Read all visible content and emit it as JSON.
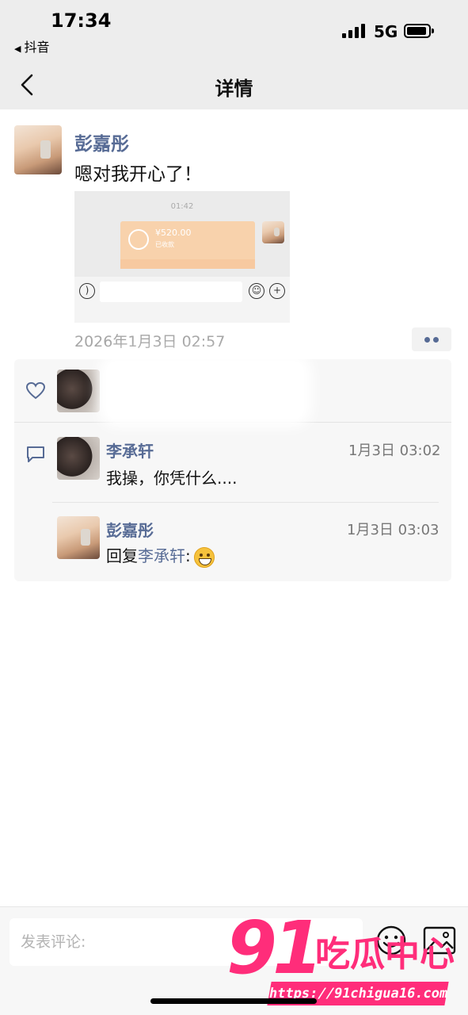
{
  "status_bar": {
    "time": "17:34",
    "back_app": "抖音",
    "network": "5G"
  },
  "nav": {
    "title": "详情",
    "back_icon": "chevron-left-icon"
  },
  "post": {
    "author": "彭嘉彤",
    "text": "嗯对我开心了！",
    "date": "2026年1月3日 02:57",
    "image": {
      "time": "01:42",
      "amount": "¥520.00",
      "status": "已收款"
    }
  },
  "likes": {
    "icon": "heart-icon"
  },
  "comments": [
    {
      "name": "李承轩",
      "time": "1月3日 03:02",
      "text": "我操，你凭什么...."
    },
    {
      "name": "彭嘉彤",
      "time": "1月3日 03:03",
      "reply_prefix": "回复",
      "reply_to": "李承轩",
      "reply_suffix": ":",
      "emoji": "grinning-emoji"
    }
  ],
  "input": {
    "placeholder": "发表评论:"
  },
  "watermark": {
    "number": "91",
    "name": "吃瓜中心",
    "url": "https://91chigua16.com"
  },
  "colors": {
    "link_name": "#576b95",
    "background_bar": "#ededed",
    "watermark": "#ff2d7a"
  }
}
